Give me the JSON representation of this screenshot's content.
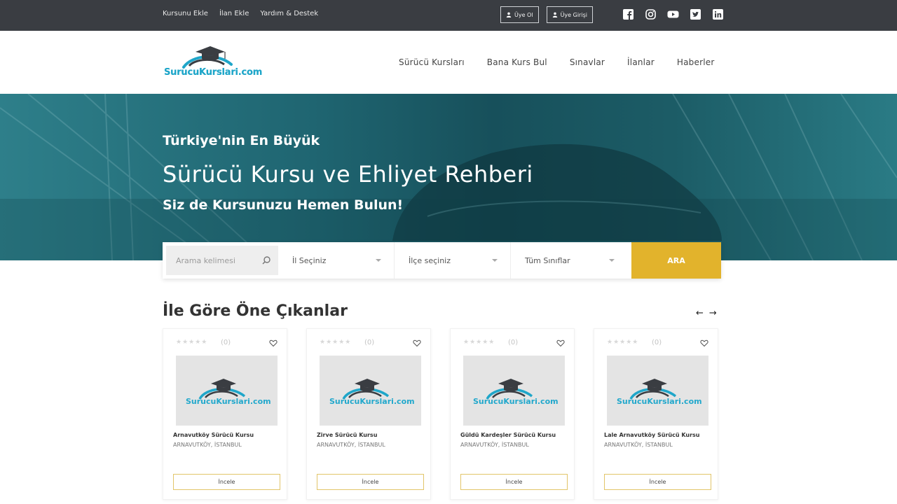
{
  "topbar": {
    "links": [
      "Kursunu Ekle",
      "İlan Ekle",
      "Yardım & Destek"
    ],
    "auth": [
      {
        "label": "Üye Ol",
        "icon": "user-icon"
      },
      {
        "label": "Üye Girişi",
        "icon": "user-icon"
      }
    ],
    "social": [
      "facebook-icon",
      "instagram-icon",
      "youtube-icon",
      "twitter-icon",
      "linkedin-icon"
    ]
  },
  "header": {
    "logo_text": "SurucuKurslari.com",
    "nav": [
      "Sürücü Kursları",
      "Bana Kurs Bul",
      "Sınavlar",
      "İlanlar",
      "Haberler"
    ]
  },
  "hero": {
    "line1": "Türkiye'nin En Büyük",
    "line2": "Sürücü Kursu ve Ehliyet Rehberi",
    "line3": "Siz de Kursunuzu Hemen Bulun!"
  },
  "search": {
    "placeholder": "Arama kelimesi",
    "city": "İl Seçiniz",
    "district": "İlçe seçiniz",
    "class": "Tüm Sınıflar",
    "button": "ARA"
  },
  "section": {
    "title": "İle Göre Öne Çıkanlar"
  },
  "cards": [
    {
      "name": "Arnavutköy Sürücü Kursu",
      "location": "ARNAVUTKÖY, İSTANBUL",
      "count": "(0)",
      "button": "İncele",
      "thumb_text": "SurucuKurslari.com"
    },
    {
      "name": "Zirve Sürücü Kursu",
      "location": "ARNAVUTKÖY, İSTANBUL",
      "count": "(0)",
      "button": "İncele",
      "thumb_text": "SurucuKurslari.com"
    },
    {
      "name": "Güldü Kardeşler Sürücü Kursu",
      "location": "ARNAVUTKÖY, İSTANBUL",
      "count": "(0)",
      "button": "İncele",
      "thumb_text": "SurucuKurslari.com"
    },
    {
      "name": "Lale Arnavutköy Sürücü Kursu",
      "location": "ARNAVUTKÖY, İSTANBUL",
      "count": "(0)",
      "button": "İncele",
      "thumb_text": "SurucuKurslari.com"
    }
  ],
  "colors": {
    "accent": "#e2b32c",
    "brand": "#1fa6c9",
    "topbar": "#3a3d42"
  }
}
